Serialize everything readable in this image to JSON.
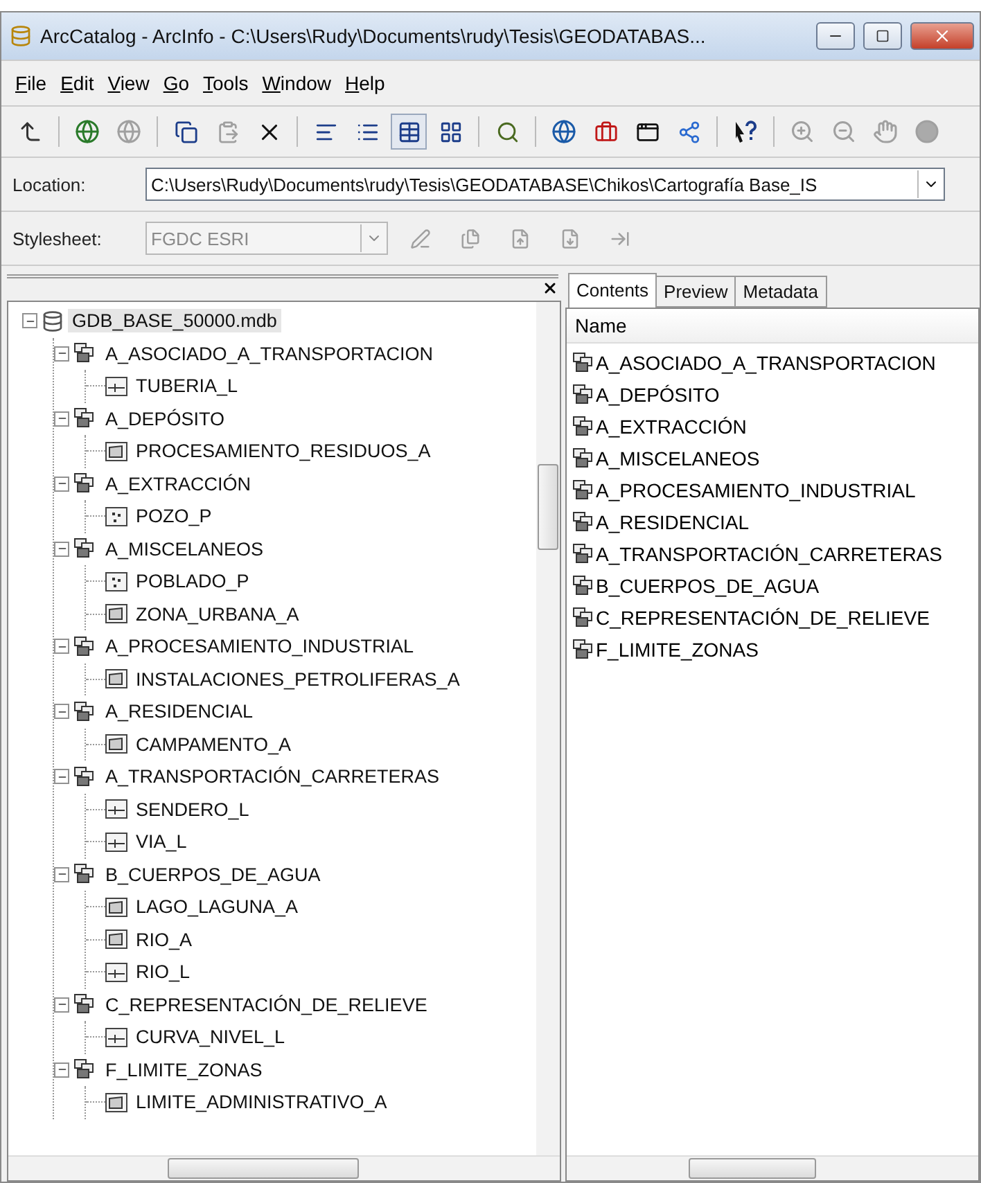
{
  "window": {
    "title": "ArcCatalog - ArcInfo - C:\\Users\\Rudy\\Documents\\rudy\\Tesis\\GEODATABAS..."
  },
  "menu": [
    "File",
    "Edit",
    "View",
    "Go",
    "Tools",
    "Window",
    "Help"
  ],
  "location": {
    "label": "Location:",
    "value": "C:\\Users\\Rudy\\Documents\\rudy\\Tesis\\GEODATABASE\\Chikos\\Cartografía Base_IS"
  },
  "stylesheet": {
    "label": "Stylesheet:",
    "value": "FGDC ESRI",
    "disabled": true
  },
  "tree": [
    {
      "label": "GDB_BASE_50000.mdb",
      "kind": "database",
      "expanded": true,
      "selected": true,
      "children": [
        {
          "label": "A_ASOCIADO_A_TRANSPORTACION",
          "kind": "dataset",
          "expanded": true,
          "selected": false,
          "children": [
            {
              "label": "TUBERIA_L",
              "kind": "line",
              "selected": false
            }
          ]
        },
        {
          "label": "A_DEPÓSITO",
          "kind": "dataset",
          "expanded": true,
          "selected": false,
          "children": [
            {
              "label": "PROCESAMIENTO_RESIDUOS_A",
              "kind": "polygon",
              "selected": false
            }
          ]
        },
        {
          "label": "A_EXTRACCIÓN",
          "kind": "dataset",
          "expanded": true,
          "selected": false,
          "children": [
            {
              "label": "POZO_P",
              "kind": "point",
              "selected": false
            }
          ]
        },
        {
          "label": "A_MISCELANEOS",
          "kind": "dataset",
          "expanded": true,
          "selected": false,
          "children": [
            {
              "label": "POBLADO_P",
              "kind": "point",
              "selected": false
            },
            {
              "label": "ZONA_URBANA_A",
              "kind": "polygon",
              "selected": false
            }
          ]
        },
        {
          "label": "A_PROCESAMIENTO_INDUSTRIAL",
          "kind": "dataset",
          "expanded": true,
          "selected": false,
          "children": [
            {
              "label": "INSTALACIONES_PETROLIFERAS_A",
              "kind": "polygon",
              "selected": false
            }
          ]
        },
        {
          "label": "A_RESIDENCIAL",
          "kind": "dataset",
          "expanded": true,
          "selected": false,
          "children": [
            {
              "label": "CAMPAMENTO_A",
              "kind": "polygon",
              "selected": false
            }
          ]
        },
        {
          "label": "A_TRANSPORTACIÓN_CARRETERAS",
          "kind": "dataset",
          "expanded": true,
          "selected": false,
          "children": [
            {
              "label": "SENDERO_L",
              "kind": "line",
              "selected": false
            },
            {
              "label": "VIA_L",
              "kind": "line",
              "selected": false
            }
          ]
        },
        {
          "label": "B_CUERPOS_DE_AGUA",
          "kind": "dataset",
          "expanded": true,
          "selected": false,
          "children": [
            {
              "label": "LAGO_LAGUNA_A",
              "kind": "polygon",
              "selected": false
            },
            {
              "label": "RIO_A",
              "kind": "polygon",
              "selected": false
            },
            {
              "label": "RIO_L",
              "kind": "line",
              "selected": false
            }
          ]
        },
        {
          "label": "C_REPRESENTACIÓN_DE_RELIEVE",
          "kind": "dataset",
          "expanded": true,
          "selected": false,
          "children": [
            {
              "label": "CURVA_NIVEL_L",
              "kind": "line",
              "selected": false
            }
          ]
        },
        {
          "label": "F_LIMITE_ZONAS",
          "kind": "dataset",
          "expanded": true,
          "selected": false,
          "children": [
            {
              "label": "LIMITE_ADMINISTRATIVO_A",
              "kind": "polygon",
              "selected": false
            }
          ]
        }
      ]
    }
  ],
  "tabs": [
    {
      "label": "Contents",
      "selected": true
    },
    {
      "label": "Preview",
      "selected": false
    },
    {
      "label": "Metadata",
      "selected": false
    }
  ],
  "contents": {
    "column": "Name",
    "rows": [
      {
        "label": "A_ASOCIADO_A_TRANSPORTACION",
        "kind": "dataset"
      },
      {
        "label": "A_DEPÓSITO",
        "kind": "dataset"
      },
      {
        "label": "A_EXTRACCIÓN",
        "kind": "dataset"
      },
      {
        "label": "A_MISCELANEOS",
        "kind": "dataset"
      },
      {
        "label": "A_PROCESAMIENTO_INDUSTRIAL",
        "kind": "dataset"
      },
      {
        "label": "A_RESIDENCIAL",
        "kind": "dataset"
      },
      {
        "label": "A_TRANSPORTACIÓN_CARRETERAS",
        "kind": "dataset"
      },
      {
        "label": "B_CUERPOS_DE_AGUA",
        "kind": "dataset"
      },
      {
        "label": "C_REPRESENTACIÓN_DE_RELIEVE",
        "kind": "dataset"
      },
      {
        "label": "F_LIMITE_ZONAS",
        "kind": "dataset"
      }
    ]
  }
}
